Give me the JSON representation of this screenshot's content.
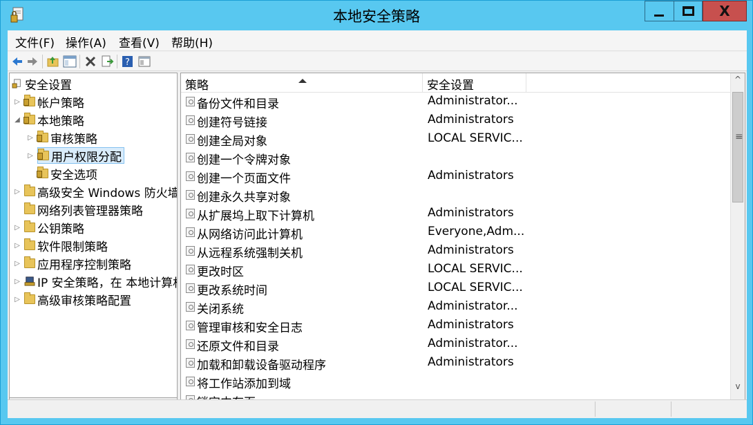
{
  "window": {
    "title": "本地安全策略"
  },
  "controls": {
    "minimize": "—",
    "maximize": "□",
    "close": "X"
  },
  "menu": [
    "文件(F)",
    "操作(A)",
    "查看(V)",
    "帮助(H)"
  ],
  "toolbar": [
    "back-icon",
    "forward-icon",
    "up-folder-icon",
    "show-hide-tree-icon",
    "delete-icon",
    "export-icon",
    "help-icon",
    "properties-icon"
  ],
  "tree": [
    {
      "label": "安全设置",
      "expander": "",
      "icon": "security-settings-icon"
    },
    {
      "label": "帐户策略",
      "expander": "▷",
      "icon": "lock-folder-icon"
    },
    {
      "label": "本地策略",
      "expander": "◢",
      "icon": "lock-folder-icon"
    },
    {
      "label": "审核策略",
      "expander": "▷",
      "icon": "lock-folder-icon"
    },
    {
      "label": "用户权限分配",
      "expander": "▷",
      "icon": "lock-folder-icon"
    },
    {
      "label": "安全选项",
      "expander": "",
      "icon": "lock-folder-icon"
    },
    {
      "label": "高级安全 Windows 防火墙",
      "expander": "▷",
      "icon": "folder-icon"
    },
    {
      "label": "网络列表管理器策略",
      "expander": "",
      "icon": "folder-icon"
    },
    {
      "label": "公钥策略",
      "expander": "▷",
      "icon": "folder-icon"
    },
    {
      "label": "软件限制策略",
      "expander": "▷",
      "icon": "folder-icon"
    },
    {
      "label": "应用程序控制策略",
      "expander": "▷",
      "icon": "folder-icon"
    },
    {
      "label": "IP 安全策略，在 本地计算机",
      "expander": "▷",
      "icon": "ip-security-icon"
    },
    {
      "label": "高级审核策略配置",
      "expander": "▷",
      "icon": "folder-icon"
    }
  ],
  "columns": {
    "policy": "策略",
    "setting": "安全设置"
  },
  "rows": [
    {
      "policy": "备份文件和目录",
      "setting": "Administrator..."
    },
    {
      "policy": "创建符号链接",
      "setting": "Administrators"
    },
    {
      "policy": "创建全局对象",
      "setting": "LOCAL SERVIC..."
    },
    {
      "policy": "创建一个令牌对象",
      "setting": ""
    },
    {
      "policy": "创建一个页面文件",
      "setting": "Administrators"
    },
    {
      "policy": "创建永久共享对象",
      "setting": ""
    },
    {
      "policy": "从扩展坞上取下计算机",
      "setting": "Administrators"
    },
    {
      "policy": "从网络访问此计算机",
      "setting": "Everyone,Adm..."
    },
    {
      "policy": "从远程系统强制关机",
      "setting": "Administrators"
    },
    {
      "policy": "更改时区",
      "setting": "LOCAL SERVIC..."
    },
    {
      "policy": "更改系统时间",
      "setting": "LOCAL SERVIC..."
    },
    {
      "policy": "关闭系统",
      "setting": "Administrator..."
    },
    {
      "policy": "管理审核和安全日志",
      "setting": "Administrators"
    },
    {
      "policy": "还原文件和目录",
      "setting": "Administrator..."
    },
    {
      "policy": "加载和卸载设备驱动程序",
      "setting": "Administrators"
    },
    {
      "policy": "将工作站添加到域",
      "setting": ""
    },
    {
      "policy": "锁定内存页",
      "setting": ""
    }
  ],
  "hscroll": {
    "left": "<",
    "right": ">",
    "grip": "|||"
  },
  "vscroll": {
    "up": "^",
    "down": "v",
    "grip": "≡"
  }
}
